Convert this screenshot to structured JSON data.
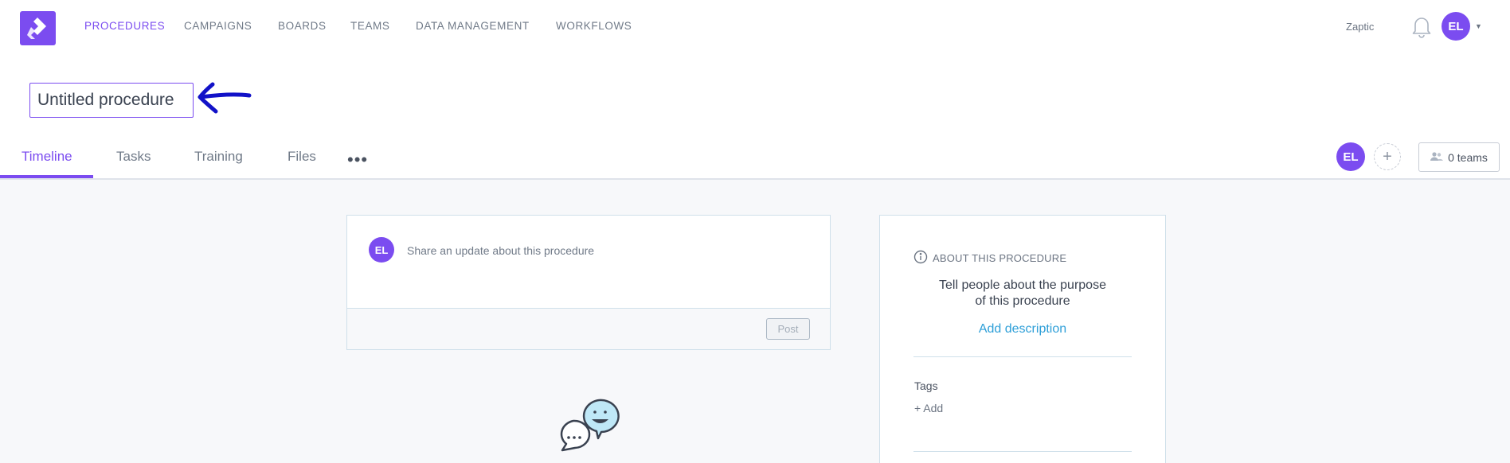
{
  "nav": {
    "items": [
      {
        "label": "PROCEDURES",
        "active": true
      },
      {
        "label": "CAMPAIGNS",
        "active": false
      },
      {
        "label": "BOARDS",
        "active": false
      },
      {
        "label": "TEAMS",
        "active": false
      },
      {
        "label": "DATA MANAGEMENT",
        "active": false
      },
      {
        "label": "WORKFLOWS",
        "active": false
      }
    ]
  },
  "header": {
    "org_name": "Zaptic",
    "user_initials": "EL",
    "bell_icon": "bell-icon",
    "caret_icon": "chevron-down-icon"
  },
  "procedure": {
    "title_value": "Untitled procedure"
  },
  "tabs": [
    {
      "label": "Timeline",
      "active": true
    },
    {
      "label": "Tasks",
      "active": false
    },
    {
      "label": "Training",
      "active": false
    },
    {
      "label": "Files",
      "active": false
    }
  ],
  "more_tabs_icon": "more-horizontal-icon",
  "members": {
    "initials": "EL",
    "add_icon": "plus-icon",
    "teams_label": "0 teams",
    "teams_icon": "users-icon"
  },
  "composer": {
    "initials": "EL",
    "placeholder": "Share an update about this procedure",
    "post_label": "Post"
  },
  "about": {
    "header": "ABOUT THIS PROCEDURE",
    "info_icon": "info-icon",
    "description_line1": "Tell people about the purpose",
    "description_line2": "of this procedure",
    "add_description": "Add description",
    "tags_label": "Tags",
    "tags_add": "+ Add"
  },
  "colors": {
    "brand": "#7b4cf0",
    "link": "#2e9fd8",
    "annotation": "#1212c8"
  }
}
